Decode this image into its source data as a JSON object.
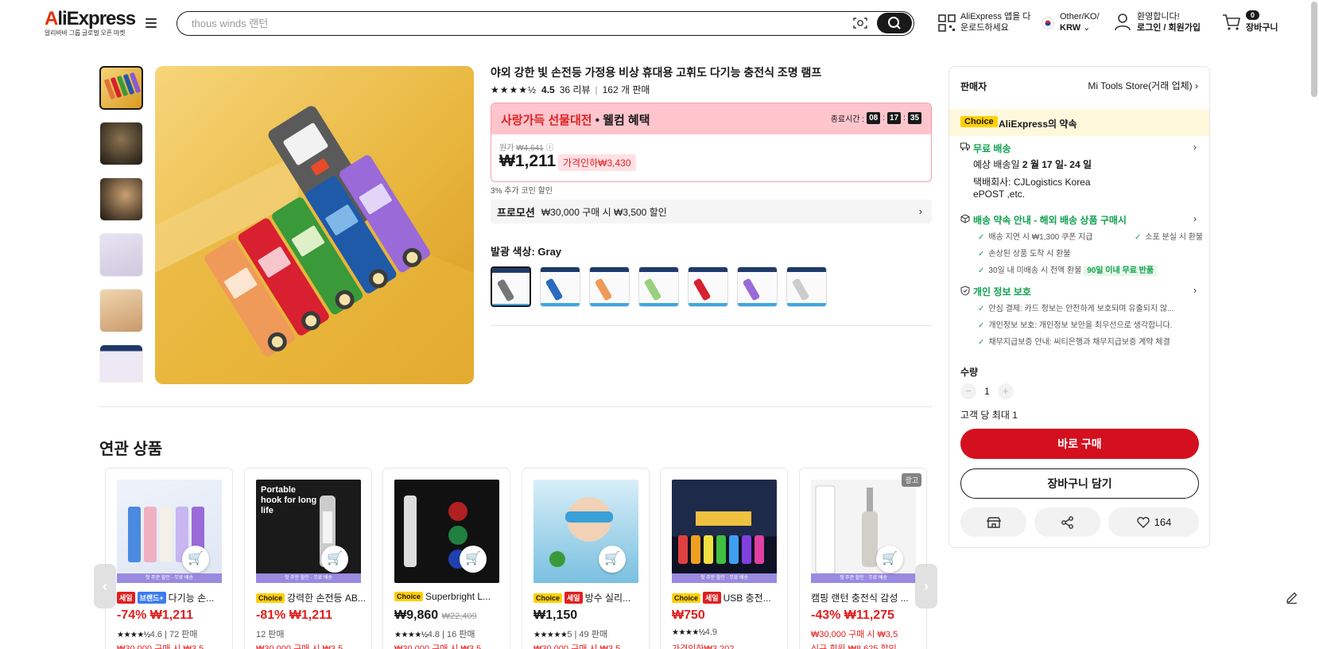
{
  "header": {
    "logo_brand": "AliExpress",
    "logo_tagline": "알리바바 그룹 글로벌 오픈 마켓",
    "search_placeholder": "thous winds 랜턴",
    "app_line1": "AliExpress 앱을 다",
    "app_line2": "운로드하세요",
    "locale_line1": "Other/KO/",
    "locale_line2": "KRW",
    "account_line1": "환영합니다!",
    "account_line2": "로그인 / 회원가입",
    "cart_count": "0",
    "cart_label": "장바구니"
  },
  "product": {
    "title": "야외 강한 빛 손전등 가정용 비상 휴대용 고휘도 다기능 충전식 조명 램프",
    "rating": "4.5",
    "reviews": "36 리뷰",
    "sold": "162 개 판매",
    "promo_title": "사랑가득 선물대전",
    "promo_sub": "• 웰컴 혜택",
    "timer_label": "종료시간 :",
    "timer_h": "08",
    "timer_m": "17",
    "timer_s": "35",
    "orig_label": "원가",
    "orig_price": "₩4,641",
    "price": "₩1,211",
    "discount_badge": "가격인하₩3,430",
    "coin_discount": "3% 추가 코인 할인",
    "promo_row_label": "프로모션",
    "promo_row_text": "₩30,000 구매 시 ₩3,500 할인",
    "color_label": "발광 색상: Gray"
  },
  "sidebar": {
    "seller_label": "판매자",
    "store_name": "Mi Tools Store(거래 업체)",
    "choice_tag": "Choice",
    "choice_text": "AliExpress의 약속",
    "shipping_head": "무료 배송",
    "shipping_eta_prefix": "예상 배송일 ",
    "shipping_eta": "2 월 17 일- 24 일",
    "carrier_line1": "택배회사:  CJLogistics  Korea",
    "carrier_line2": "ePOST ,etc.",
    "delivery_head": "배송 약속 안내 - 해외 배송 상품 구매시",
    "delivery_items": [
      "배송 지연 시 ₩1,300 쿠폰 지급",
      "소포 분실 시 환불",
      "손상된 상품 도착 시 환불",
      "30일 내 미배송 시 전액 환불"
    ],
    "return_tag": "90일 이내 무료 반품",
    "privacy_head": "개인 정보 보호",
    "privacy_items": [
      "안심 결제: 카드 정보는 안전하게 보호되며 유출되지 않...",
      "개인정보 보호: 개인정보 보안을 최우선으로 생각합니다.",
      "채무지급보증 안내: 씨티은행과 채무지급보증 계약 체결"
    ],
    "qty_label": "수량",
    "qty_value": "1",
    "qty_minus": "−",
    "qty_plus": "+",
    "max_label": "고객 당 최대 1",
    "buy_now": "바로 구매",
    "add_cart": "장바구니 담기",
    "wishlist_count": "164"
  },
  "related": {
    "title": "연관 상품",
    "ad_tag": "광고",
    "cards": [
      {
        "badge1": "세일",
        "badge2": "브랜드+",
        "name": "다기능 손...",
        "price": "-74% ₩1,211",
        "meta_stars": "★★★★½",
        "meta": "4.6 | 72 판매",
        "coupon": "₩30,000 구매 시 ₩3,5",
        "ribbon": "첫 주문 할인 · 무료 배송"
      },
      {
        "badge1": "Choice",
        "name": "강력한 손전등 AB...",
        "price": "-81% ₩1,211",
        "meta": "12 판매",
        "coupon": "₩30,000 구매 시 ₩3,5",
        "ribbon": "첫 주문 할인 · 무료 배송"
      },
      {
        "badge1": "Choice",
        "name": "Superbright L...",
        "price": "₩9,860",
        "orig": "₩22,409",
        "meta_stars": "★★★★½",
        "meta": "4.8 | 16 판매",
        "coupon": "₩30,000 구매 시 ₩3,5"
      },
      {
        "badge1": "Choice",
        "badge2": "세일",
        "name": "방수 실리...",
        "price": "₩1,150",
        "meta_stars": "★★★★★",
        "meta": "5 | 49 판매",
        "coupon": "₩30,000 구매 시 ₩3,5"
      },
      {
        "badge1": "Choice",
        "badge2": "세일",
        "name": "USB 충전...",
        "price": "₩750",
        "meta_stars": "★★★★½",
        "meta": "4.9",
        "coupon": "가격인하₩3,202",
        "ribbon": "첫 주문 할인 · 무료 배송"
      },
      {
        "name": "캠핑 랜턴 충전식 감성 ...",
        "price": "-43% ₩11,275",
        "coupon": "₩30,000 구매 시 ₩3,5",
        "coupon2": "신규 회원 ₩8,625 할인",
        "ribbon": "첫 주문 할인 · 무료 배송"
      }
    ]
  }
}
